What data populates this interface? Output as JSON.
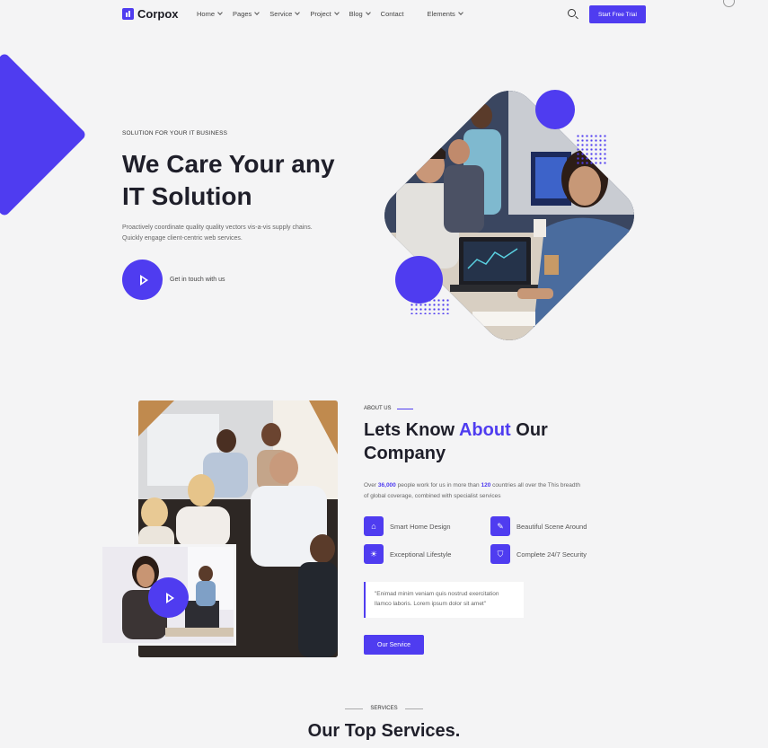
{
  "nav": {
    "brand": "Corpox",
    "items": [
      {
        "label": "Home",
        "dropdown": true
      },
      {
        "label": "Pages",
        "dropdown": true
      },
      {
        "label": "Service",
        "dropdown": true
      },
      {
        "label": "Project",
        "dropdown": true
      },
      {
        "label": "Blog",
        "dropdown": true
      },
      {
        "label": "Contact",
        "dropdown": false
      },
      {
        "label": "Elements",
        "dropdown": true
      }
    ],
    "cta_label": "Start Free Trial"
  },
  "hero": {
    "eyebrow": "SOLUTION FOR YOUR IT BUSINESS",
    "title_line1": "We Care Your any",
    "title_line2": "IT Solution",
    "desc_line1": "Proactively coordinate quality quality vectors vis-a-vis supply chains.",
    "desc_line2": "Quickly engage client-centric web services.",
    "play_label": "Get in touch with us"
  },
  "about": {
    "eyebrow": "ABOUT US",
    "title_pre": "Lets Know ",
    "title_accent": "About",
    "title_post": " Our",
    "title_line2": "Company",
    "desc_pre": "Over ",
    "desc_num1": "36,000",
    "desc_mid": " people work for us in more than ",
    "desc_num2": "120",
    "desc_post": " countries all over the This breadth",
    "desc_line2": "of global coverage, combined with specialist services",
    "features": [
      {
        "label": "Smart Home Design",
        "icon": "home-icon"
      },
      {
        "label": "Beautiful Scene Around",
        "icon": "brush-icon"
      },
      {
        "label": "Exceptional Lifestyle",
        "icon": "lightbulb-icon"
      },
      {
        "label": "Complete 24/7 Security",
        "icon": "shield-icon"
      }
    ],
    "quote_line1": "\"Enimad minim veniam quis nostrud exercitation",
    "quote_line2": "llamco laboris. Lorem ipsum dolor sit amet\"",
    "button_label": "Our Service"
  },
  "services": {
    "eyebrow": "SERVICES",
    "title": "Our Top Services."
  },
  "colors": {
    "accent": "#4f3cf0",
    "background": "#f4f4f5"
  }
}
